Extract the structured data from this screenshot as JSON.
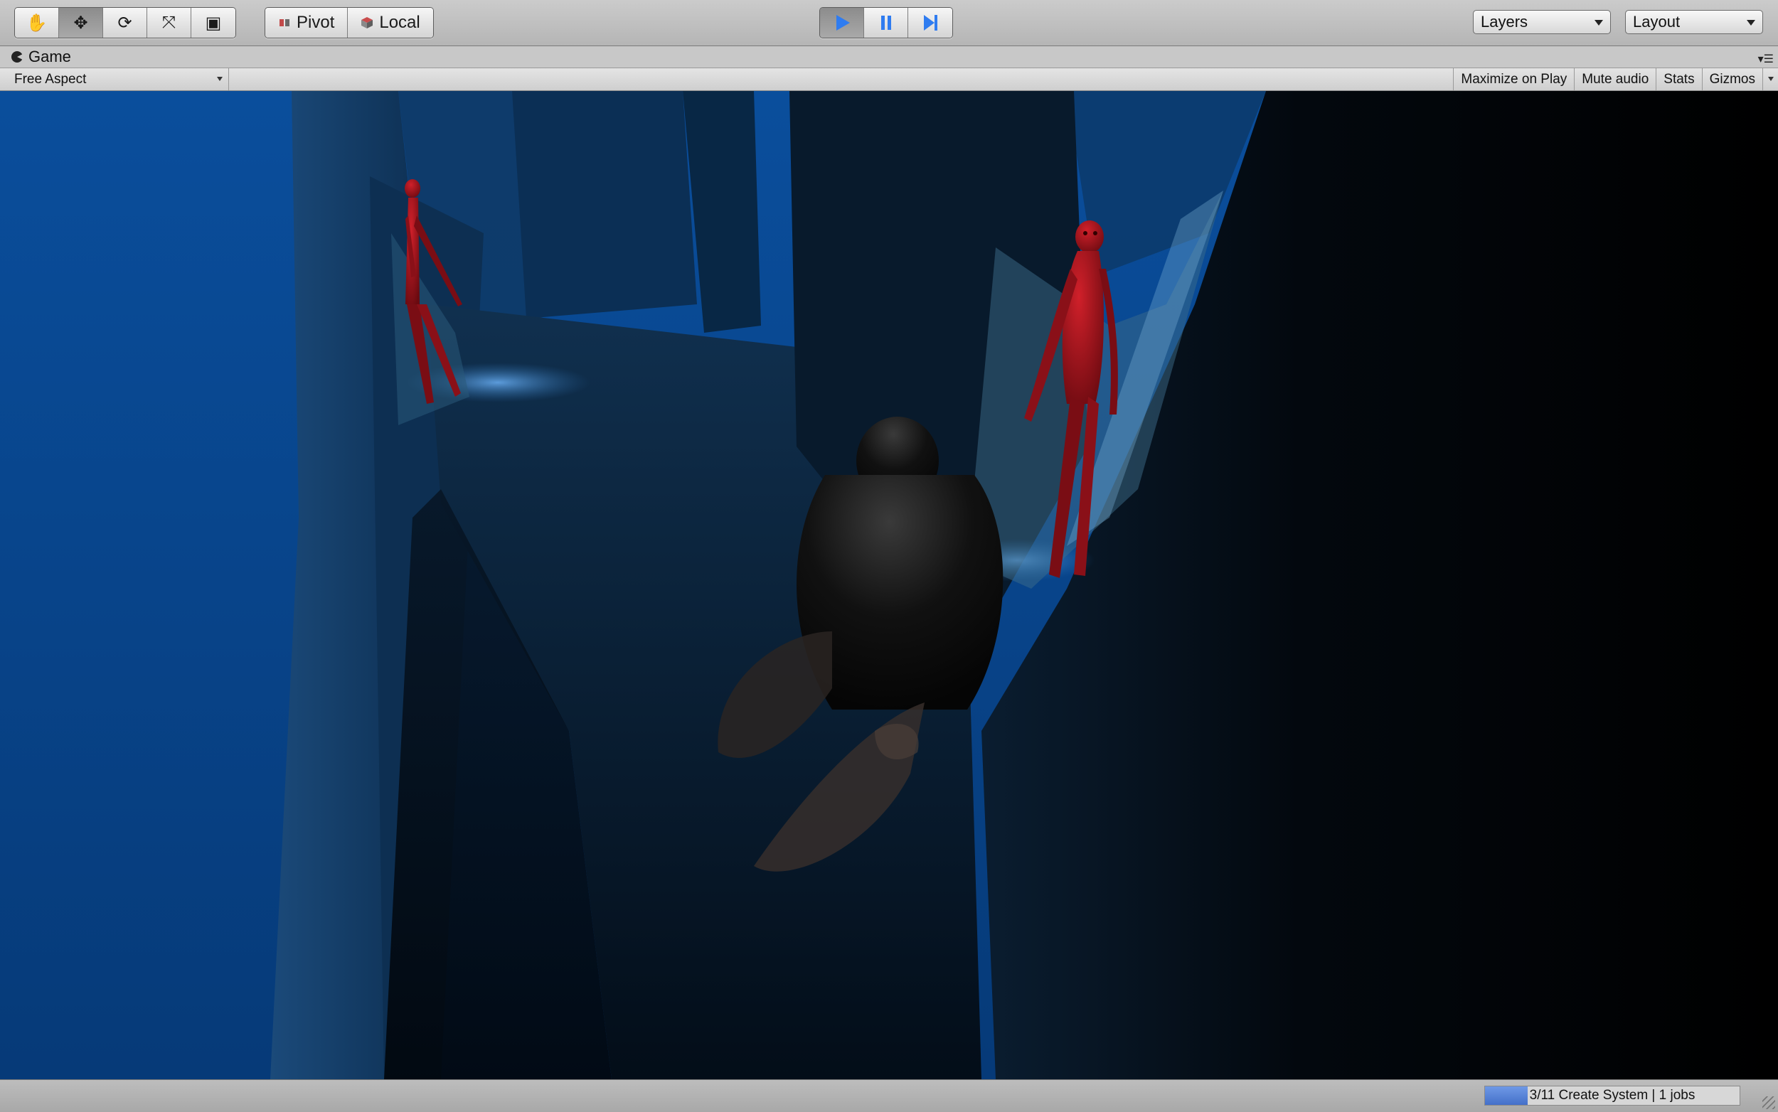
{
  "toolbar": {
    "tools": [
      {
        "name": "hand-tool",
        "icon": "hand-icon",
        "glyph": "✋",
        "active": false
      },
      {
        "name": "move-tool",
        "icon": "move-arrows-icon",
        "glyph": "✥",
        "active": true
      },
      {
        "name": "rotate-tool",
        "icon": "rotate-icon",
        "glyph": "⟳",
        "active": false
      },
      {
        "name": "scale-tool",
        "icon": "scale-icon",
        "glyph": "⤧",
        "active": false
      },
      {
        "name": "rect-tool",
        "icon": "rect-transform-icon",
        "glyph": "▣",
        "active": false
      }
    ],
    "pivot_label": "Pivot",
    "local_label": "Local",
    "play_glyph": "▶",
    "pause_glyph": "❚❚",
    "step_glyph": "▶|",
    "layers_label": "Layers",
    "layout_label": "Layout",
    "accent_color": "#2f7cf0"
  },
  "game_panel": {
    "tab_label": "Game",
    "aspect_label": "Free Aspect",
    "options": [
      "Maximize on Play",
      "Mute audio",
      "Stats",
      "Gizmos"
    ]
  },
  "status": {
    "progress_text": "3/11 Create System | 1 jobs",
    "progress_fraction": 0.1667
  }
}
